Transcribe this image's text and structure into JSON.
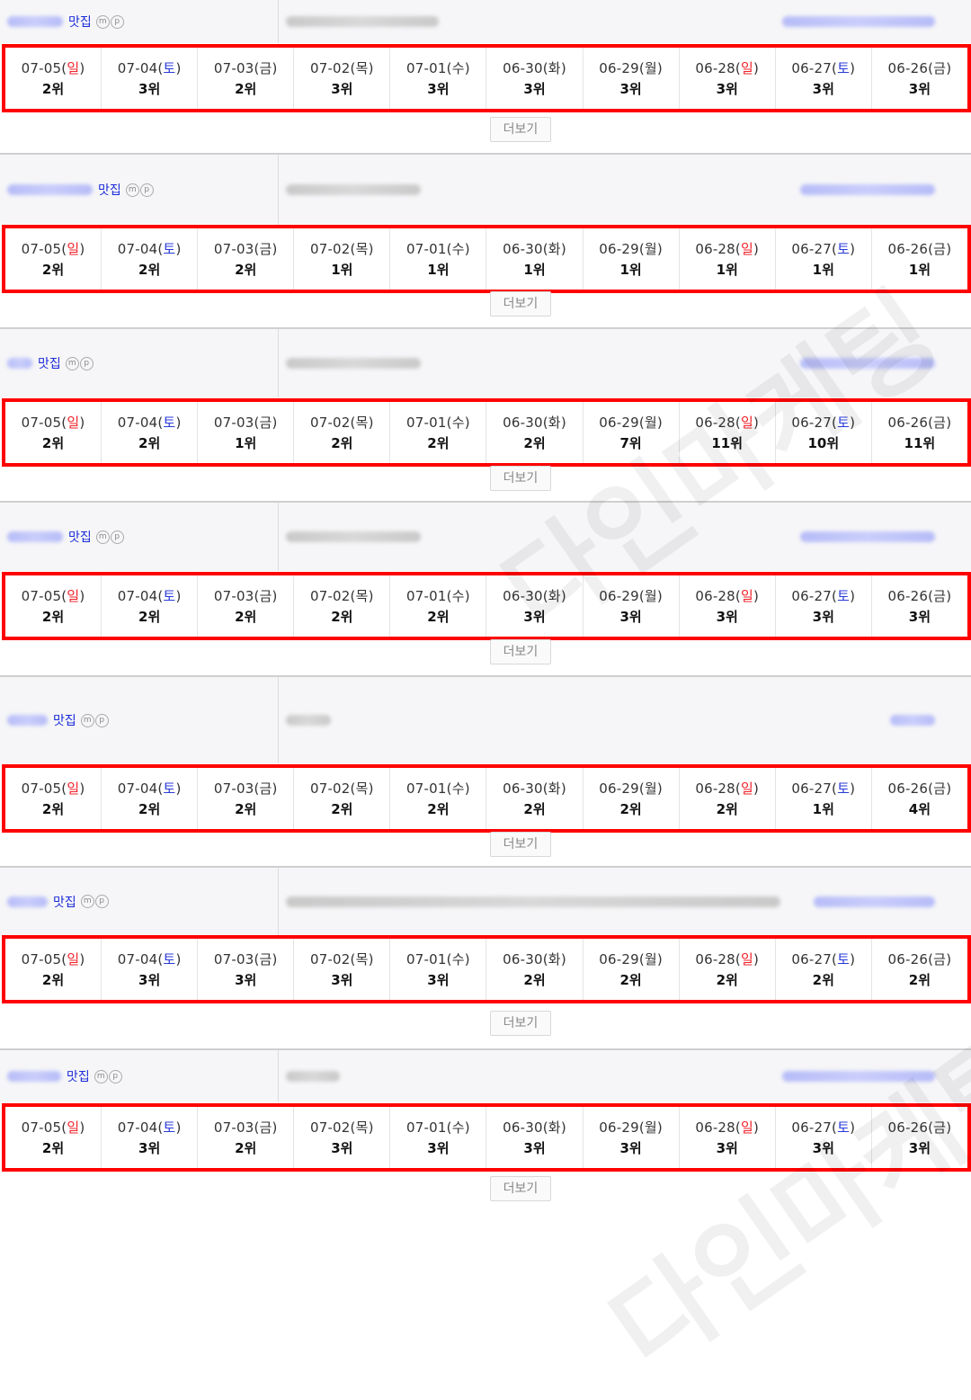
{
  "keyword_suffix": "맛집",
  "badge_m": "m",
  "badge_p": "p",
  "more_label": "더보기",
  "watermark": "다인마케팅",
  "days": [
    {
      "date": "07-05",
      "day": "일",
      "kind": "sun"
    },
    {
      "date": "07-04",
      "day": "토",
      "kind": "sat"
    },
    {
      "date": "07-03",
      "day": "금",
      "kind": "wk"
    },
    {
      "date": "07-02",
      "day": "목",
      "kind": "wk"
    },
    {
      "date": "07-01",
      "day": "수",
      "kind": "wk"
    },
    {
      "date": "06-30",
      "day": "화",
      "kind": "wk"
    },
    {
      "date": "06-29",
      "day": "월",
      "kind": "wk"
    },
    {
      "date": "06-28",
      "day": "일",
      "kind": "sun"
    },
    {
      "date": "06-27",
      "day": "토",
      "kind": "sat"
    },
    {
      "date": "06-26",
      "day": "금",
      "kind": "wk"
    }
  ],
  "rows": [
    {
      "ranks": [
        "2위",
        "3위",
        "2위",
        "3위",
        "3위",
        "3위",
        "3위",
        "3위",
        "3위",
        "3위"
      ]
    },
    {
      "ranks": [
        "2위",
        "2위",
        "2위",
        "1위",
        "1위",
        "1위",
        "1위",
        "1위",
        "1위",
        "1위"
      ]
    },
    {
      "ranks": [
        "2위",
        "2위",
        "1위",
        "2위",
        "2위",
        "2위",
        "7위",
        "11위",
        "10위",
        "11위"
      ]
    },
    {
      "ranks": [
        "2위",
        "2위",
        "2위",
        "2위",
        "2위",
        "3위",
        "3위",
        "3위",
        "3위",
        "3위"
      ]
    },
    {
      "ranks": [
        "2위",
        "2위",
        "2위",
        "2위",
        "2위",
        "2위",
        "2위",
        "2위",
        "1위",
        "4위"
      ]
    },
    {
      "ranks": [
        "2위",
        "3위",
        "3위",
        "3위",
        "3위",
        "2위",
        "2위",
        "2위",
        "2위",
        "2위"
      ]
    },
    {
      "ranks": [
        "2위",
        "3위",
        "2위",
        "3위",
        "3위",
        "3위",
        "3위",
        "3위",
        "3위",
        "3위"
      ]
    }
  ]
}
